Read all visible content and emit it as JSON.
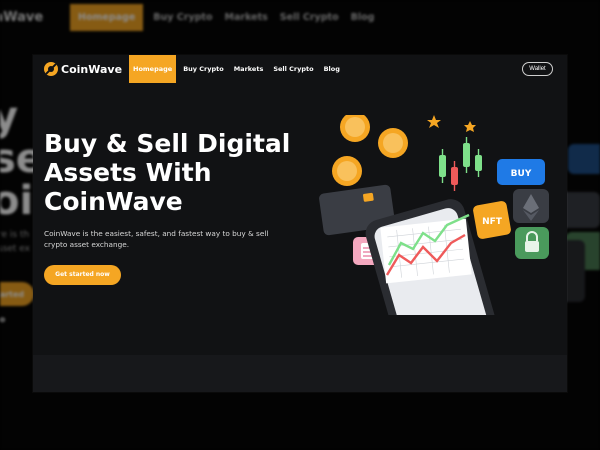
{
  "background": {
    "brand_fragment": "nWave",
    "nav": [
      "Homepage",
      "Buy Crypto",
      "Markets",
      "Sell Crypto",
      "Blog"
    ],
    "hero_lines": [
      "y",
      "se",
      "oi"
    ],
    "para_lines": [
      "re is th",
      "sset ex"
    ],
    "cta_fragment": "tarted no"
  },
  "brand": {
    "name": "CoinWave",
    "logo": "coin-logo-icon"
  },
  "nav": {
    "items": [
      {
        "label": "Homepage",
        "active": true
      },
      {
        "label": "Buy Crypto",
        "active": false
      },
      {
        "label": "Markets",
        "active": false
      },
      {
        "label": "Sell Crypto",
        "active": false
      },
      {
        "label": "Blog",
        "active": false
      }
    ],
    "wallet_label": "Wallet"
  },
  "hero": {
    "title_lines": [
      "Buy & Sell Digital",
      "Assets With",
      "CoinWave"
    ],
    "description_lines": [
      "CoinWave is the easiest, safest, and fastest way to buy & sell",
      "crypto asset exchange."
    ],
    "cta_label": "Get started now"
  },
  "illustration": {
    "buy_label": "BUY",
    "nft_label": "NFT",
    "icons": [
      "bitcoin-coin-icon",
      "ethereum-icon",
      "lock-icon",
      "calculator-icon",
      "credit-card-icon",
      "star-icon",
      "phone-icon"
    ]
  },
  "colors": {
    "accent": "#f5a623",
    "modal_bg": "#111214",
    "buy_blue": "#1f7ae6",
    "candle_green": "#7ee08a",
    "candle_red": "#ef5a5a"
  }
}
